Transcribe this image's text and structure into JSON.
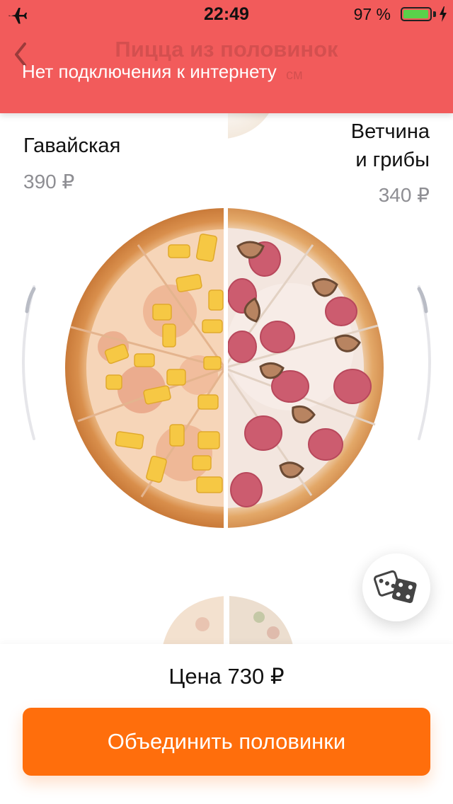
{
  "status_bar": {
    "time": "22:49",
    "battery_percent": "97 %",
    "battery_level": 0.97,
    "airplane_mode": true,
    "charging": true,
    "battery_color": "#5ad24a"
  },
  "header": {
    "title": "Пицца из половинок",
    "subtitle": "см"
  },
  "banner": {
    "text": "Нет подключения к интернету",
    "color": "#f25b5b"
  },
  "left_half": {
    "name": "Гавайская",
    "price": "390 ₽"
  },
  "right_half": {
    "name_line1": "Ветчина",
    "name_line2": "и грибы",
    "price": "340 ₽"
  },
  "footer": {
    "price_label": "Цена 730 ₽",
    "button_label": "Объединить половинки",
    "button_color": "#ff6e0c"
  },
  "icons": {
    "airplane": "airplane-icon",
    "dice": "dice-icon",
    "back": "chevron-left-icon"
  }
}
